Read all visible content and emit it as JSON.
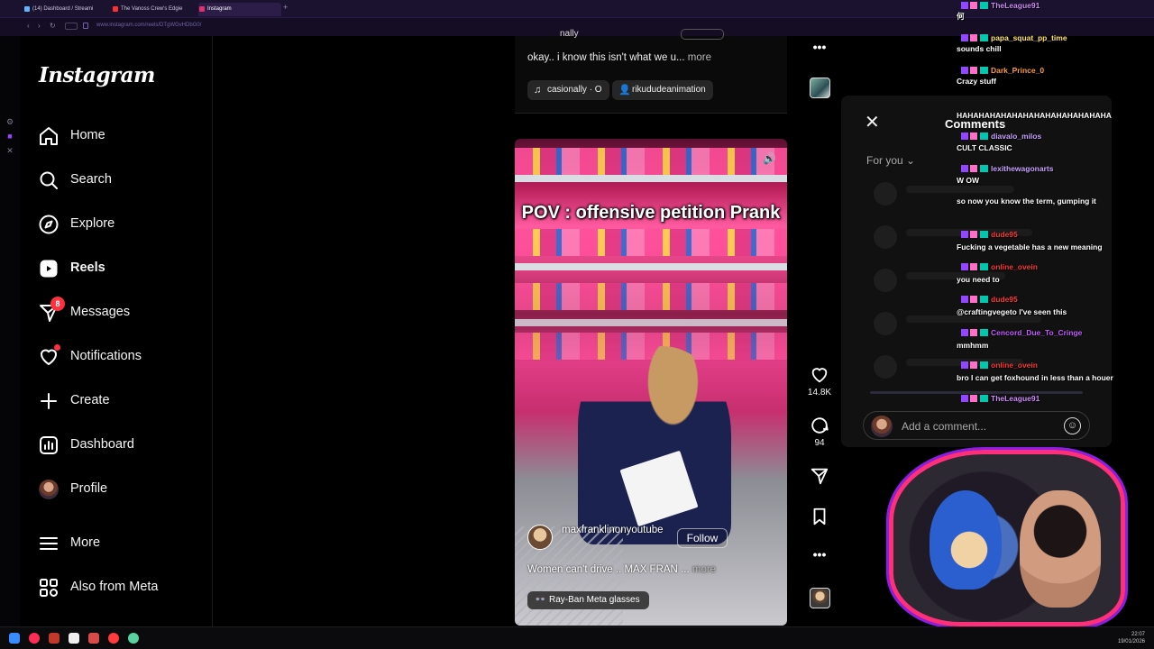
{
  "browser": {
    "tabs": [
      {
        "label": "(14) Dashboard / Streami",
        "color": "#5fb3ff"
      },
      {
        "label": "The Vanoss Crew's Edgie",
        "color": "#ff2d2d"
      },
      {
        "label": "Instagram",
        "color": "#e1306c"
      }
    ],
    "url": "www.instagram.com/reels/DTgWGvHDbG0/"
  },
  "sidebar": {
    "logo": "Instagram",
    "items": [
      {
        "label": "Home",
        "icon": "home-icon"
      },
      {
        "label": "Search",
        "icon": "search-icon"
      },
      {
        "label": "Explore",
        "icon": "compass-icon"
      },
      {
        "label": "Reels",
        "icon": "reels-icon"
      },
      {
        "label": "Messages",
        "icon": "messenger-icon",
        "badge": "8"
      },
      {
        "label": "Notifications",
        "icon": "heart-icon"
      },
      {
        "label": "Create",
        "icon": "plus-icon"
      },
      {
        "label": "Dashboard",
        "icon": "dashboard-icon"
      },
      {
        "label": "Profile",
        "icon": "avatar"
      },
      {
        "label": "More",
        "icon": "menu-icon"
      },
      {
        "label": "Also from Meta",
        "icon": "meta-apps-icon"
      }
    ]
  },
  "prev_post": {
    "username": "nally",
    "caption": "okay.. i know this isn't what we u...",
    "more": "more",
    "audio_chip": "casionally · O",
    "user_chip": "rikududeanimation"
  },
  "reel": {
    "overlay_text": "POV : offensive petition Prank",
    "username": "maxfranklinonyoutube",
    "follow": "Follow",
    "caption": "Women can't drive .. MAX FRAN ...",
    "more": "more",
    "meta_chip": "Ray-Ban Meta glasses",
    "likes": "14.8K",
    "comments": "94"
  },
  "comments_panel": {
    "title": "Comments",
    "sort": "For you",
    "placeholder": "Add a comment..."
  },
  "chat": [
    {
      "name": "TheLeague91",
      "msg": "",
      "color": "#d08cff"
    },
    {
      "name": "",
      "msg": "何",
      "color": "#fff"
    },
    {
      "name": "papa_squat_pp_time",
      "msg": "",
      "color": "#ffe36a"
    },
    {
      "name": "",
      "msg": "sounds chill",
      "color": "#fff"
    },
    {
      "name": "Dark_Prince_0",
      "msg": "",
      "color": "#ff9a3c"
    },
    {
      "name": "",
      "msg": "Crazy stuff",
      "color": "#fff"
    },
    {
      "name": "",
      "msg": "HAHAHAHAHAHAHAHAHAHAHAHAHAHA",
      "color": "#fff"
    },
    {
      "name": "diavalo_milos",
      "msg": "",
      "color": "#c9a3ff"
    },
    {
      "name": "",
      "msg": "CULT CLASSIC",
      "color": "#fff"
    },
    {
      "name": "lexithewagonarts",
      "msg": "",
      "color": "#c9a3ff"
    },
    {
      "name": "",
      "msg": "W OW",
      "color": "#fff"
    },
    {
      "name": "",
      "msg": "so now you know the term, gumping it",
      "color": "#fff"
    },
    {
      "name": "dude95",
      "msg": "",
      "color": "#ff3a3a"
    },
    {
      "name": "",
      "msg": "Fucking a vegetable has a new meaning",
      "color": "#fff"
    },
    {
      "name": "online_ovein",
      "msg": "",
      "color": "#ff3a3a"
    },
    {
      "name": "",
      "msg": "you need to",
      "color": "#fff"
    },
    {
      "name": "dude95",
      "msg": "",
      "color": "#ff3a3a"
    },
    {
      "name": "",
      "msg": "@craftingvegeto I've seen this",
      "color": "#fff"
    },
    {
      "name": "Cencord_Due_To_Cringe",
      "msg": "",
      "color": "#c55cff"
    },
    {
      "name": "",
      "msg": "mmhmm",
      "color": "#fff"
    },
    {
      "name": "online_ovein",
      "msg": "",
      "color": "#ff3a3a"
    },
    {
      "name": "",
      "msg": "bro I can get foxhound in less than a houer",
      "color": "#fff"
    },
    {
      "name": "TheLeague91",
      "msg": "",
      "color": "#d08cff"
    }
  ],
  "clock": {
    "time": "22:07",
    "date": "19/01/2026"
  }
}
